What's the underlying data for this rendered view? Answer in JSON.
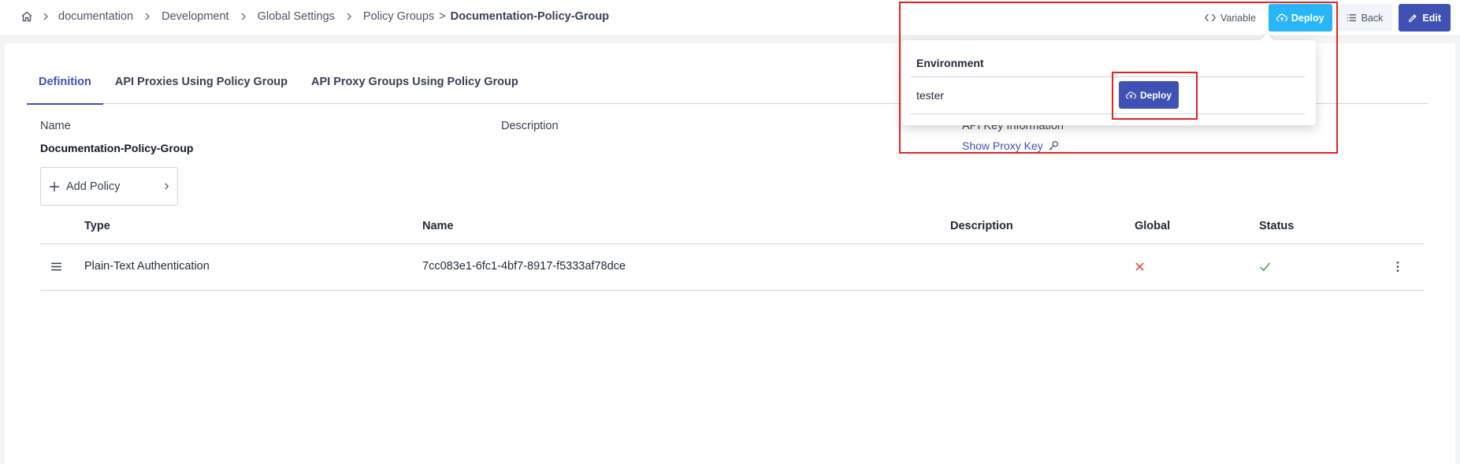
{
  "breadcrumb": {
    "items": [
      "documentation",
      "Development",
      "Global Settings",
      "Policy Groups"
    ],
    "separator_last": ">",
    "current": "Documentation-Policy-Group"
  },
  "toolbar": {
    "variable_label": "Variable",
    "deploy_label": "Deploy",
    "back_label": "Back",
    "edit_label": "Edit"
  },
  "tabs": [
    {
      "label": "Definition",
      "active": true
    },
    {
      "label": "API Proxies Using Policy Group",
      "active": false
    },
    {
      "label": "API Proxy Groups Using Policy Group",
      "active": false
    }
  ],
  "fields": {
    "name_label": "Name",
    "name_value": "Documentation-Policy-Group",
    "description_label": "Description",
    "api_key_label": "API Key Information",
    "show_proxy_key": "Show Proxy Key"
  },
  "add_policy_label": "Add Policy",
  "table": {
    "headers": [
      "Type",
      "Name",
      "Description",
      "Global",
      "Status"
    ],
    "rows": [
      {
        "type": "Plain-Text Authentication",
        "name": "7cc083e1-6fc1-4bf7-8917-f5333af78dce",
        "description": "",
        "global": false,
        "status": true
      }
    ]
  },
  "deploy_popover": {
    "environment_header": "Environment",
    "environments": [
      {
        "name": "tester",
        "action_label": "Deploy"
      }
    ]
  },
  "colors": {
    "primary": "#3f51b5",
    "deploy_top": "#29b6f6",
    "error_x": "#e53935",
    "success_check": "#43a047",
    "highlight": "#e02424"
  }
}
